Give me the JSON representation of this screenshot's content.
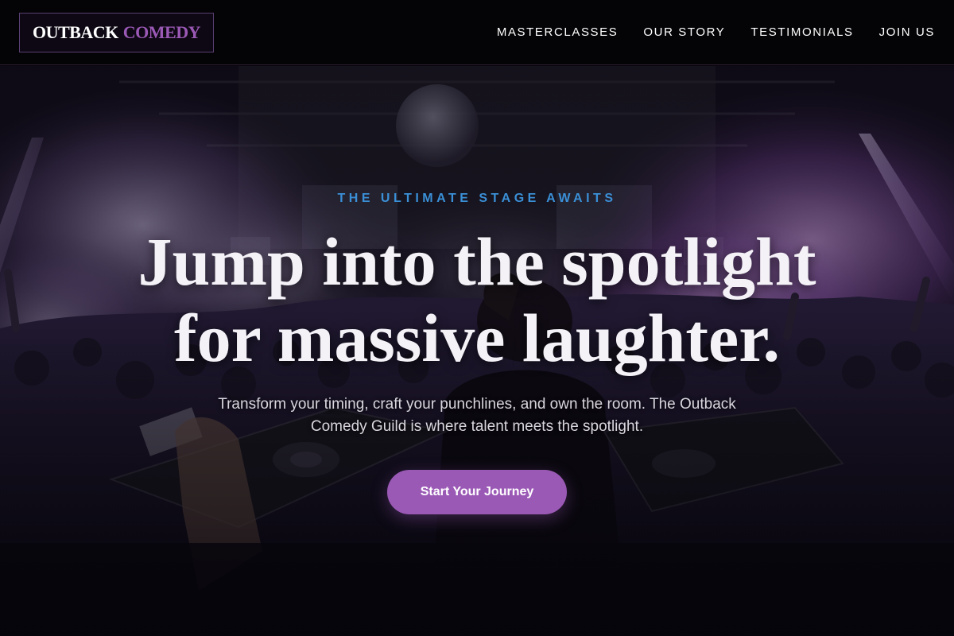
{
  "brand": {
    "name_part1": "OUTBACK",
    "name_part2": "COMEDY",
    "accent_color": "#9b59b6"
  },
  "nav": {
    "items": [
      {
        "label": "MASTERCLASSES"
      },
      {
        "label": "OUR STORY"
      },
      {
        "label": "TESTIMONIALS"
      },
      {
        "label": "JOIN US"
      }
    ]
  },
  "hero": {
    "eyebrow": "THE ULTIMATE STAGE AWAITS",
    "headline_line1": "Jump into the spotlight",
    "headline_line2": "for massive laughter.",
    "subtext": "Transform your timing, craft your punchlines, and own the room. The Outback Comedy Guild is where talent meets the spotlight.",
    "cta_label": "Start Your Journey",
    "eyebrow_color": "#3a8fd6",
    "background_image": "concert-crowd-image"
  }
}
